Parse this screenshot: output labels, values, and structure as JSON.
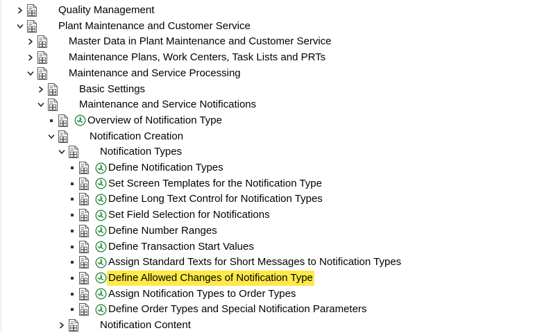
{
  "tree": [
    {
      "label": "Quality Management",
      "state": "collapsed",
      "level": 0
    },
    {
      "label": "Plant Maintenance and Customer Service",
      "state": "expanded",
      "level": 0
    },
    {
      "label": "Master Data in Plant Maintenance and Customer Service",
      "state": "collapsed",
      "level": 1
    },
    {
      "label": "Maintenance Plans, Work Centers, Task Lists and PRTs",
      "state": "collapsed",
      "level": 1
    },
    {
      "label": "Maintenance and Service Processing",
      "state": "expanded",
      "level": 1
    },
    {
      "label": "Basic Settings",
      "state": "collapsed",
      "level": 2
    },
    {
      "label": "Maintenance and Service Notifications",
      "state": "expanded",
      "level": 2
    },
    {
      "label": "Overview of Notification Type",
      "state": "leaf",
      "level": 3
    },
    {
      "label": "Notification Creation",
      "state": "expanded",
      "level": 3
    },
    {
      "label": "Notification Types",
      "state": "expanded",
      "level": 4
    },
    {
      "label": "Define Notification Types",
      "state": "leaf",
      "level": 5
    },
    {
      "label": "Set Screen Templates for the Notification Type",
      "state": "leaf",
      "level": 5
    },
    {
      "label": "Define Long Text Control for Notification Types",
      "state": "leaf",
      "level": 5
    },
    {
      "label": "Set Field Selection for Notifications",
      "state": "leaf",
      "level": 5
    },
    {
      "label": "Define Number Ranges",
      "state": "leaf",
      "level": 5
    },
    {
      "label": "Define Transaction Start Values",
      "state": "leaf",
      "level": 5
    },
    {
      "label": "Assign Standard Texts for Short Messages to Notification Types",
      "state": "leaf",
      "level": 5
    },
    {
      "label": "Define Allowed Changes of Notification Type",
      "state": "leaf",
      "level": 5,
      "highlighted": true
    },
    {
      "label": "Assign Notification Types to Order Types",
      "state": "leaf",
      "level": 5
    },
    {
      "label": "Define Order Types and Special Notification Parameters",
      "state": "leaf",
      "level": 5
    },
    {
      "label": "Notification Content",
      "state": "collapsed",
      "level": 4
    }
  ],
  "colors": {
    "highlight": "#ffe94a",
    "exec_icon": "#2e8b3c",
    "doc_icon": "#5a5a5a"
  },
  "icons": {
    "collapsed": "chevron-right-icon",
    "expanded": "chevron-down-icon",
    "leaf": "bullet-icon",
    "node": "document-icon",
    "activity": "execute-clock-icon"
  }
}
